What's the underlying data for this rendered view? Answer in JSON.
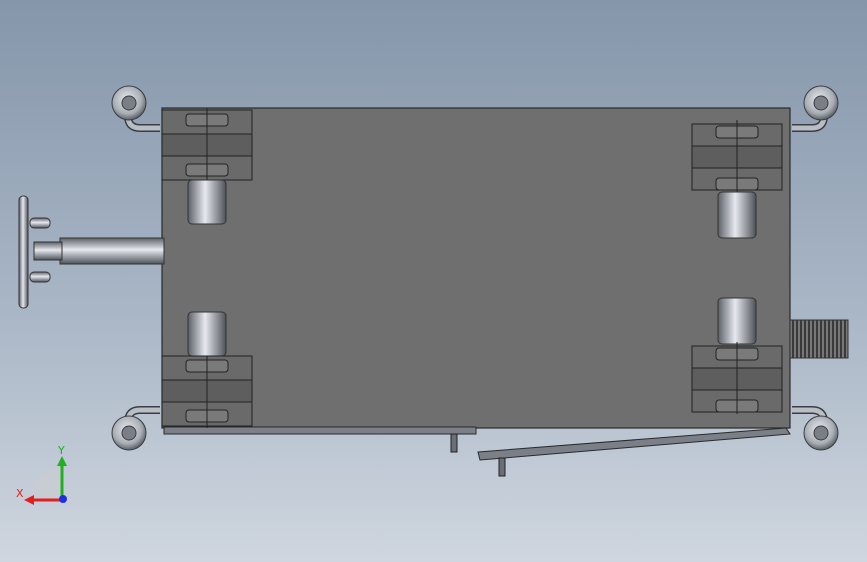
{
  "viewport": {
    "background_top": "#8596aa",
    "background_bottom": "#cfd6df"
  },
  "model": {
    "body_color": "#6f6f6f",
    "edge_color": "#2a2a2a",
    "metal_light": "#c9cdd3",
    "metal_dark": "#5a5f66"
  },
  "triad": {
    "x_label": "X",
    "y_label": "Y",
    "x_color": "#e02020",
    "y_color": "#20b020",
    "z_color": "#2030e0"
  }
}
